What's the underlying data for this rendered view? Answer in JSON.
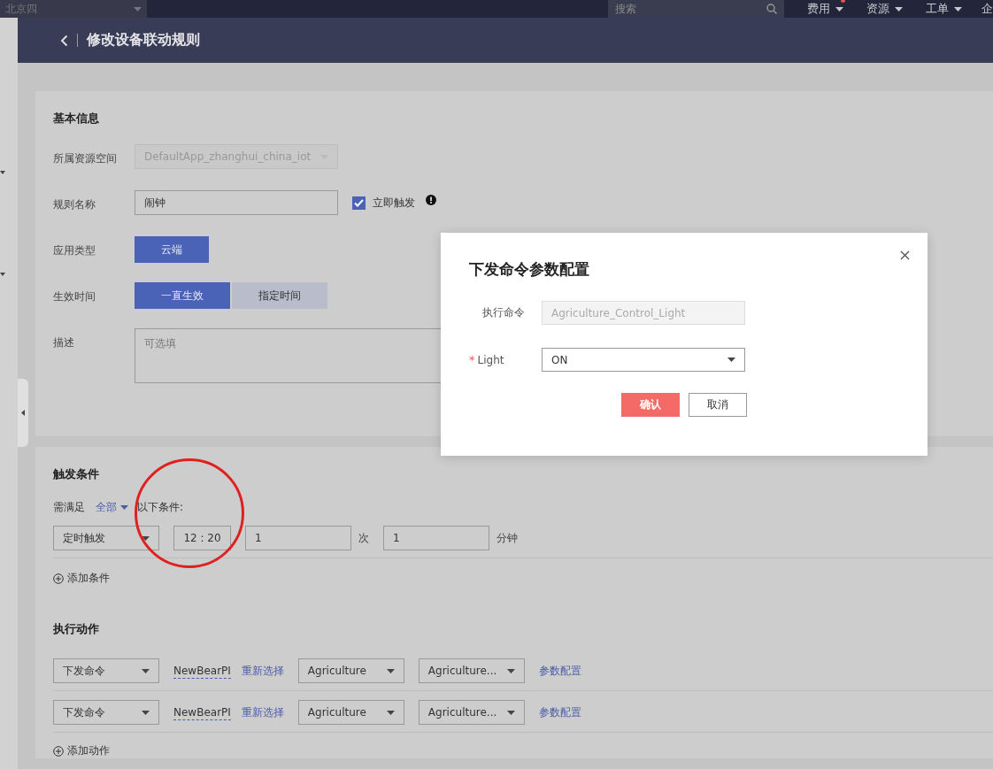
{
  "top_bar": {
    "region": "北京四",
    "search": {
      "placeholder": "搜索"
    },
    "menus": [
      {
        "label": "费用",
        "dropdown": true,
        "badge": true
      },
      {
        "label": "资源",
        "dropdown": true
      },
      {
        "label": "工单",
        "dropdown": true
      },
      {
        "label": "企",
        "dropdown": false
      }
    ]
  },
  "header": {
    "title": "修改设备联动规则"
  },
  "basic_info": {
    "title": "基本信息",
    "fields": [
      {
        "kind": "select",
        "label": "所属资源空间",
        "value": "DefaultApp_zhanghui_china_iot",
        "disabled": true
      },
      {
        "kind": "input",
        "label": "规则名称",
        "value": "闹钟",
        "checkbox": {
          "label": "立即触发",
          "checked": true
        }
      },
      {
        "kind": "segmented",
        "label": "应用类型",
        "options": [
          {
            "label": "云端",
            "selected": true
          }
        ]
      },
      {
        "kind": "segmented",
        "label": "生效时间",
        "options": [
          {
            "label": "一直生效",
            "selected": true
          },
          {
            "label": "指定时间",
            "selected": false
          }
        ]
      },
      {
        "kind": "textarea",
        "label": "描述",
        "placeholder": "可选填"
      }
    ]
  },
  "trigger": {
    "title": "触发条件",
    "match_prefix": "需满足",
    "match_value": "全部",
    "match_suffix": "以下条件:",
    "conditions": [
      {
        "type": "定时触发",
        "time": "12 : 20",
        "count": "1",
        "count_unit": "次",
        "interval": "1",
        "interval_unit": "分钟"
      }
    ],
    "add_label": "添加条件"
  },
  "actions": {
    "title": "执行动作",
    "rows": [
      {
        "type": "下发命令",
        "device": "NewBearPI",
        "reselect": "重新选择",
        "product": "Agriculture",
        "command": "Agriculture...",
        "config": "参数配置"
      },
      {
        "type": "下发命令",
        "device": "NewBearPI",
        "reselect": "重新选择",
        "product": "Agriculture",
        "command": "Agriculture...",
        "config": "参数配置"
      }
    ],
    "add_label": "添加动作"
  },
  "dialog": {
    "title": "下发命令参数配置",
    "required_mark": "*",
    "fields": [
      {
        "kind": "readonly",
        "label": "执行命令",
        "value": "Agriculture_Control_Light",
        "required": false
      },
      {
        "kind": "select",
        "label": "Light",
        "value": "ON",
        "required": true
      }
    ],
    "buttons": [
      {
        "label": "确认",
        "primary": true
      },
      {
        "label": "取消",
        "primary": false
      }
    ]
  }
}
